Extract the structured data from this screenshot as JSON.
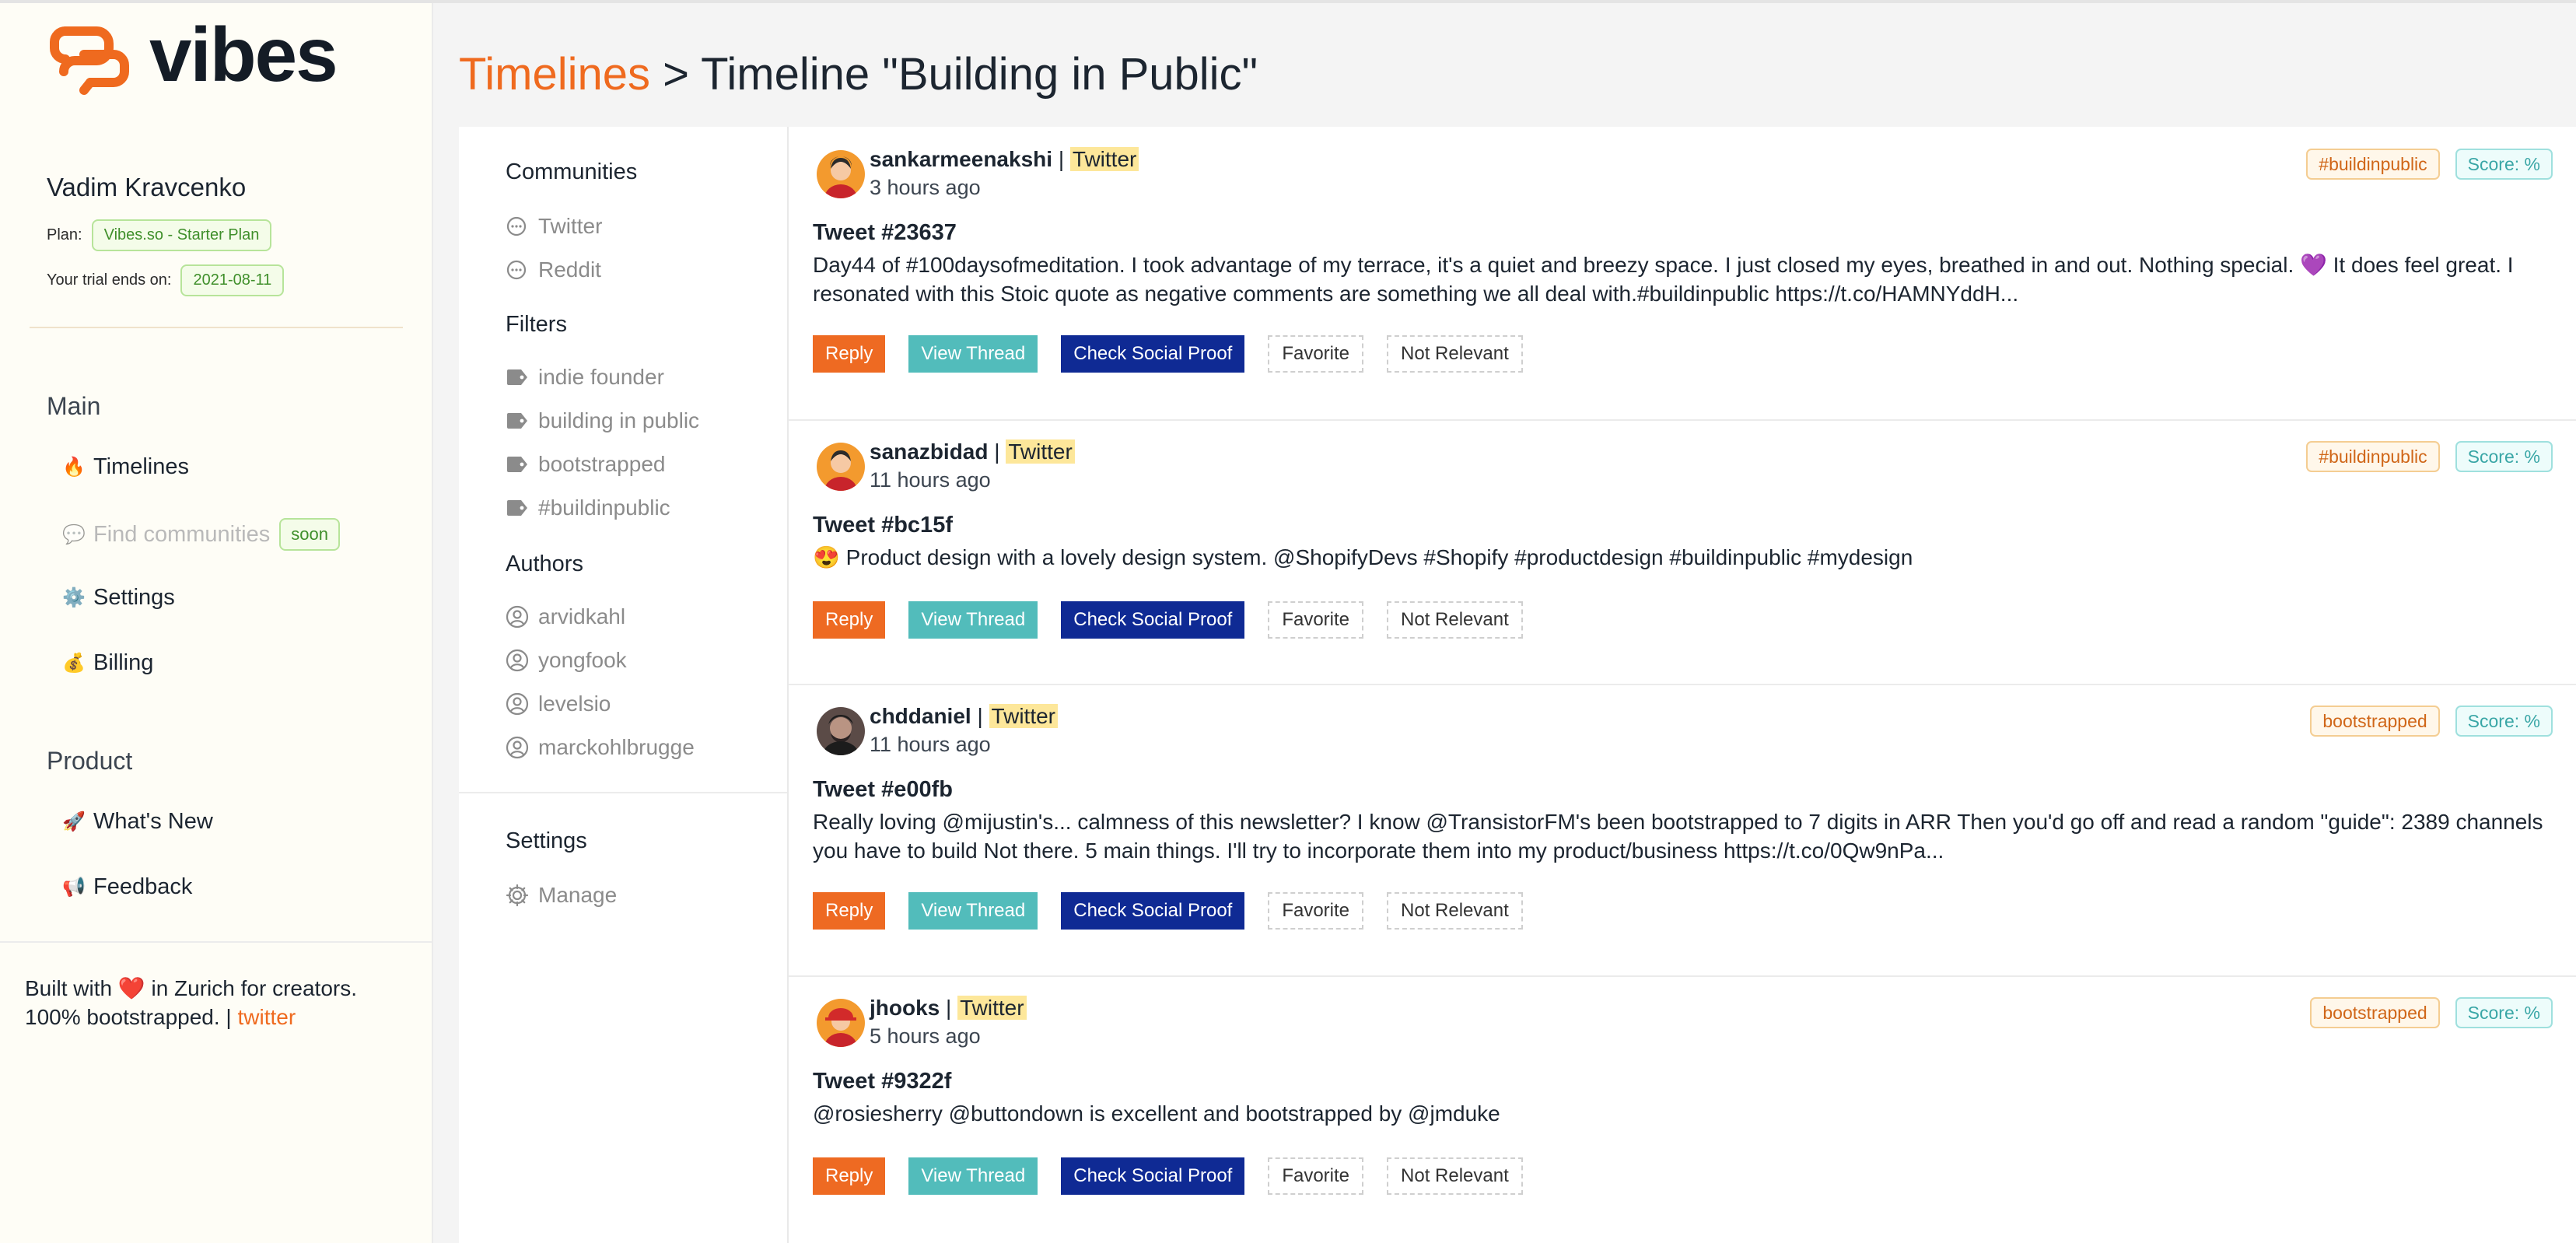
{
  "app": {
    "name": "vibes"
  },
  "user": {
    "name": "Vadim Kravcenko",
    "plan_label": "Plan:",
    "plan": "Vibes.so - Starter Plan",
    "trial_label": "Your trial ends on:",
    "trial_end": "2021-08-11"
  },
  "sidebar": {
    "main_title": "Main",
    "main_items": [
      {
        "icon": "🔥",
        "label": "Timelines"
      },
      {
        "icon": "💬",
        "label": "Find communities",
        "badge": "soon"
      },
      {
        "icon": "⚙️",
        "label": "Settings"
      },
      {
        "icon": "💰",
        "label": "Billing"
      }
    ],
    "product_title": "Product",
    "product_items": [
      {
        "icon": "🚀",
        "label": "What's New"
      },
      {
        "icon": "📢",
        "label": "Feedback"
      }
    ],
    "footer": {
      "line1_a": "Built with",
      "heart": "❤️",
      "line1_b": "in Zurich for creators.",
      "line2": "100% bootstrapped. |",
      "link": "twitter"
    }
  },
  "header": {
    "crumb": "Timelines",
    "separator": ">",
    "title": "Timeline \"Building in Public\""
  },
  "filters": {
    "communities_title": "Communities",
    "communities": [
      "Twitter",
      "Reddit"
    ],
    "filters_title": "Filters",
    "filters": [
      "indie founder",
      "building in public",
      "bootstrapped",
      "#buildinpublic"
    ],
    "authors_title": "Authors",
    "authors": [
      "arvidkahl",
      "yongfook",
      "levelsio",
      "marckohlbrugge"
    ],
    "settings_title": "Settings",
    "manage": "Manage"
  },
  "actions": {
    "reply": "Reply",
    "view_thread": "View Thread",
    "social_proof": "Check Social Proof",
    "favorite": "Favorite",
    "not_relevant": "Not Relevant"
  },
  "tweets": [
    {
      "author": "sankarmeenakshi",
      "sep": "|",
      "platform": "Twitter",
      "time": "3 hours ago",
      "title": "Tweet #23637",
      "body": "Day44 of #100daysofmeditation. I took advantage of my terrace, it's a quiet and breezy space. I just closed my eyes, breathed in and out. Nothing special. 💜 It does feel great. I resonated with this Stoic quote as negative comments are something we all deal with.#buildinpublic https://t.co/HAMNYddH...",
      "tag": "#buildinpublic",
      "score": "Score: %"
    },
    {
      "author": "sanazbidad",
      "sep": "|",
      "platform": "Twitter",
      "time": "11 hours ago",
      "title": "Tweet #bc15f",
      "body": "😍  Product design with a lovely design system. @ShopifyDevs #Shopify #productdesign #buildinpublic #mydesign",
      "tag": "#buildinpublic",
      "score": "Score: %"
    },
    {
      "author": "chddaniel",
      "sep": "|",
      "platform": "Twitter",
      "time": "11 hours ago",
      "title": "Tweet #e00fb",
      "body": "Really loving @mijustin's... calmness of this newsletter? I know @TransistorFM's been bootstrapped to 7 digits in ARR Then you'd go off and read a random \"guide\": 2389 channels you have to build Not there. 5 main things. I'll try to incorporate them into my product/business https://t.co/0Qw9nPa...",
      "tag": "bootstrapped",
      "score": "Score: %"
    },
    {
      "author": "jhooks",
      "sep": "|",
      "platform": "Twitter",
      "time": "5 hours ago",
      "title": "Tweet #9322f",
      "body": "@rosiesherry @buttondown is excellent and bootstrapped by @jmduke",
      "tag": "bootstrapped",
      "score": "Score: %"
    }
  ]
}
